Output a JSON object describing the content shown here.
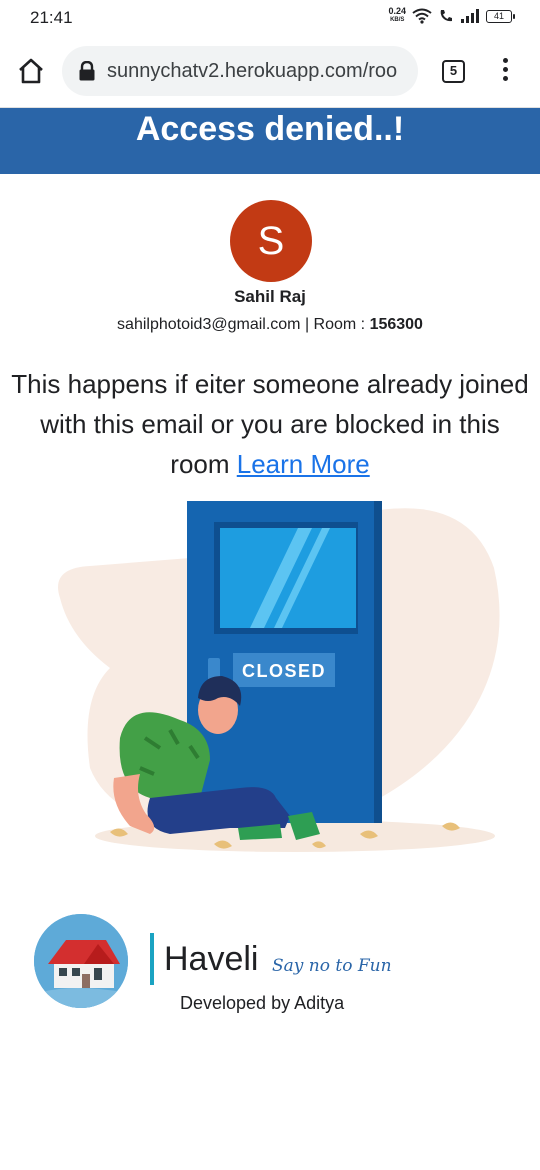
{
  "status_bar": {
    "time": "21:41",
    "net_speed_value": "0.24",
    "net_speed_unit": "KB/S",
    "battery": "41"
  },
  "browser": {
    "url": "sunnychatv2.herokuapp.com/roo",
    "tab_count": "5"
  },
  "header": {
    "title": "Access denied..!"
  },
  "profile": {
    "avatar_letter": "S",
    "name": "Sahil Raj",
    "email": "sahilphotoid3@gmail.com",
    "room_label": " | Room : ",
    "room_number": "156300",
    "avatar_color": "#c23a14"
  },
  "message": {
    "text": "This happens if eiter someone already joined with this email or you are blocked in this room ",
    "link_text": "Learn More"
  },
  "illustration": {
    "door_sign": "CLOSED"
  },
  "footer": {
    "brand": "Haveli",
    "tagline": "Say no to Fun",
    "developer": "Developed by Aditya"
  },
  "colors": {
    "header_bg": "#2a65a8",
    "link": "#1a73e8",
    "door": "#1565b0"
  }
}
